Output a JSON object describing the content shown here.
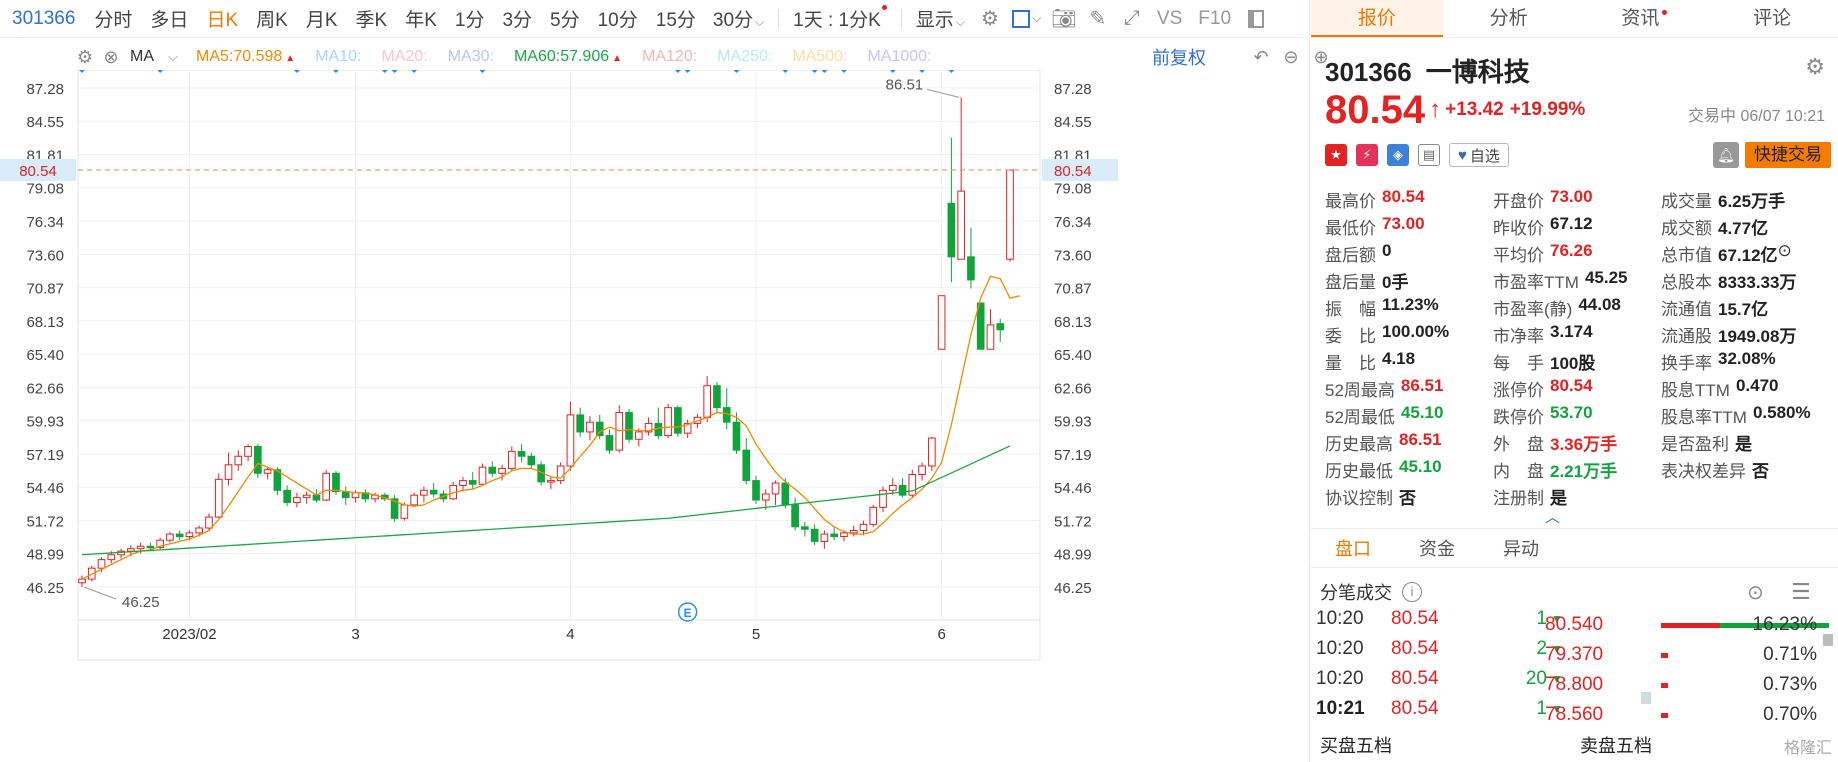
{
  "toolbar": {
    "code": "301366",
    "periods": [
      "分时",
      "多日",
      "日K",
      "周K",
      "月K",
      "季K",
      "年K",
      "1分",
      "3分",
      "5分",
      "10分",
      "15分"
    ],
    "active_period": "日K",
    "dropdown_30": "30分",
    "dropdown_day": "1天 : 1分K",
    "display_label": "显示",
    "vs_label": "VS",
    "f10_label": "F10"
  },
  "ma": {
    "label": "MA",
    "items": [
      {
        "name": "MA5:",
        "value": "70.598",
        "color": "#f08a00",
        "up": true
      },
      {
        "name": "MA10:",
        "value": "",
        "color": "#a8d4f5",
        "up": false
      },
      {
        "name": "MA20:",
        "value": "",
        "color": "#f5c4d8",
        "up": false
      },
      {
        "name": "MA30:",
        "value": "",
        "color": "#b8c8e6",
        "up": false
      },
      {
        "name": "MA60:",
        "value": "57.906",
        "color": "#1aa845",
        "up": true
      },
      {
        "name": "MA120:",
        "value": "",
        "color": "#f5b5b5",
        "up": false
      },
      {
        "name": "MA250:",
        "value": "",
        "color": "#b5ebf0",
        "up": false
      },
      {
        "name": "MA500:",
        "value": "",
        "color": "#f7e0a0",
        "up": false
      },
      {
        "name": "MA1000:",
        "value": "",
        "color": "#c9c6ea",
        "up": false
      }
    ],
    "adjust_label": "前复权"
  },
  "chart_data": {
    "type": "candlestick",
    "y_ticks": [
      "87.28",
      "84.55",
      "81.81",
      "79.08",
      "76.34",
      "73.60",
      "70.87",
      "68.13",
      "65.40",
      "62.66",
      "59.93",
      "57.19",
      "54.46",
      "51.72",
      "48.99",
      "46.25"
    ],
    "ylim": [
      46.25,
      87.28
    ],
    "x_labels": [
      {
        "label": "2023/02",
        "index": 11
      },
      {
        "label": "3",
        "index": 28
      },
      {
        "label": "4",
        "index": 50
      },
      {
        "label": "5",
        "index": 69
      },
      {
        "label": "6",
        "index": 88
      }
    ],
    "current_price": "80.54",
    "max_label": "86.51",
    "min_label": "46.25",
    "event_marker": "E",
    "event_index": 62,
    "signal_indices": [
      0,
      8,
      22,
      26,
      31,
      32,
      34,
      41,
      61,
      62,
      67,
      72,
      75,
      76,
      78,
      83,
      86,
      89
    ],
    "candles": [
      {
        "o": 46.6,
        "h": 47.2,
        "l": 46.25,
        "c": 46.9
      },
      {
        "o": 46.9,
        "h": 48.0,
        "l": 46.7,
        "c": 47.8
      },
      {
        "o": 47.8,
        "h": 48.7,
        "l": 47.5,
        "c": 48.5
      },
      {
        "o": 48.5,
        "h": 49.2,
        "l": 48.2,
        "c": 48.9
      },
      {
        "o": 48.9,
        "h": 49.4,
        "l": 48.6,
        "c": 49.2
      },
      {
        "o": 49.2,
        "h": 49.7,
        "l": 48.8,
        "c": 49.4
      },
      {
        "o": 49.4,
        "h": 49.9,
        "l": 49.0,
        "c": 49.6
      },
      {
        "o": 49.6,
        "h": 49.9,
        "l": 49.2,
        "c": 49.5
      },
      {
        "o": 49.5,
        "h": 50.3,
        "l": 49.3,
        "c": 50.1
      },
      {
        "o": 50.1,
        "h": 50.8,
        "l": 49.9,
        "c": 50.6
      },
      {
        "o": 50.6,
        "h": 50.9,
        "l": 50.1,
        "c": 50.4
      },
      {
        "o": 50.4,
        "h": 50.9,
        "l": 50.1,
        "c": 50.7
      },
      {
        "o": 50.7,
        "h": 51.3,
        "l": 50.4,
        "c": 51.1
      },
      {
        "o": 51.1,
        "h": 52.3,
        "l": 50.9,
        "c": 52.0
      },
      {
        "o": 52.0,
        "h": 55.6,
        "l": 51.9,
        "c": 55.1
      },
      {
        "o": 55.1,
        "h": 57.3,
        "l": 54.6,
        "c": 56.3
      },
      {
        "o": 56.3,
        "h": 57.5,
        "l": 55.8,
        "c": 57.0
      },
      {
        "o": 57.0,
        "h": 58.0,
        "l": 56.6,
        "c": 57.8
      },
      {
        "o": 57.8,
        "h": 58.0,
        "l": 55.2,
        "c": 55.6
      },
      {
        "o": 55.6,
        "h": 56.1,
        "l": 55.1,
        "c": 55.9
      },
      {
        "o": 55.9,
        "h": 56.1,
        "l": 53.8,
        "c": 54.2
      },
      {
        "o": 54.2,
        "h": 54.6,
        "l": 52.9,
        "c": 53.2
      },
      {
        "o": 53.2,
        "h": 54.0,
        "l": 52.8,
        "c": 53.6
      },
      {
        "o": 53.6,
        "h": 54.1,
        "l": 53.1,
        "c": 53.8
      },
      {
        "o": 53.8,
        "h": 54.3,
        "l": 53.2,
        "c": 53.4
      },
      {
        "o": 53.4,
        "h": 55.9,
        "l": 53.3,
        "c": 55.6
      },
      {
        "o": 55.6,
        "h": 55.8,
        "l": 53.8,
        "c": 54.1
      },
      {
        "o": 54.1,
        "h": 54.5,
        "l": 53.0,
        "c": 53.6
      },
      {
        "o": 53.6,
        "h": 54.2,
        "l": 53.2,
        "c": 54.0
      },
      {
        "o": 54.0,
        "h": 54.3,
        "l": 53.2,
        "c": 53.5
      },
      {
        "o": 53.5,
        "h": 54.0,
        "l": 53.2,
        "c": 53.8
      },
      {
        "o": 53.8,
        "h": 54.0,
        "l": 53.3,
        "c": 53.5
      },
      {
        "o": 53.5,
        "h": 53.8,
        "l": 51.6,
        "c": 51.9
      },
      {
        "o": 51.9,
        "h": 53.2,
        "l": 51.7,
        "c": 53.0
      },
      {
        "o": 53.0,
        "h": 54.0,
        "l": 52.8,
        "c": 53.8
      },
      {
        "o": 53.8,
        "h": 54.5,
        "l": 53.2,
        "c": 54.2
      },
      {
        "o": 54.2,
        "h": 54.8,
        "l": 53.6,
        "c": 53.9
      },
      {
        "o": 53.9,
        "h": 54.2,
        "l": 53.2,
        "c": 53.5
      },
      {
        "o": 53.5,
        "h": 54.9,
        "l": 53.4,
        "c": 54.6
      },
      {
        "o": 54.6,
        "h": 55.3,
        "l": 54.1,
        "c": 55.0
      },
      {
        "o": 55.0,
        "h": 55.7,
        "l": 54.3,
        "c": 54.7
      },
      {
        "o": 54.7,
        "h": 56.4,
        "l": 54.6,
        "c": 56.1
      },
      {
        "o": 56.1,
        "h": 56.6,
        "l": 55.3,
        "c": 55.6
      },
      {
        "o": 55.6,
        "h": 56.3,
        "l": 55.0,
        "c": 56.0
      },
      {
        "o": 56.0,
        "h": 57.8,
        "l": 55.8,
        "c": 57.4
      },
      {
        "o": 57.4,
        "h": 58.0,
        "l": 56.5,
        "c": 57.0
      },
      {
        "o": 57.0,
        "h": 57.3,
        "l": 56.0,
        "c": 56.3
      },
      {
        "o": 56.3,
        "h": 56.6,
        "l": 54.6,
        "c": 54.9
      },
      {
        "o": 54.9,
        "h": 55.3,
        "l": 54.3,
        "c": 55.0
      },
      {
        "o": 55.0,
        "h": 56.5,
        "l": 54.7,
        "c": 56.2
      },
      {
        "o": 56.2,
        "h": 61.5,
        "l": 55.8,
        "c": 60.4
      },
      {
        "o": 60.4,
        "h": 61.0,
        "l": 58.6,
        "c": 59.0
      },
      {
        "o": 59.0,
        "h": 60.3,
        "l": 58.3,
        "c": 59.8
      },
      {
        "o": 59.8,
        "h": 60.4,
        "l": 58.4,
        "c": 58.7
      },
      {
        "o": 58.7,
        "h": 59.2,
        "l": 57.2,
        "c": 57.5
      },
      {
        "o": 57.5,
        "h": 61.2,
        "l": 57.3,
        "c": 60.6
      },
      {
        "o": 60.6,
        "h": 60.9,
        "l": 58.1,
        "c": 58.4
      },
      {
        "o": 58.4,
        "h": 59.3,
        "l": 57.8,
        "c": 59.0
      },
      {
        "o": 59.0,
        "h": 60.2,
        "l": 58.7,
        "c": 59.7
      },
      {
        "o": 59.7,
        "h": 61.0,
        "l": 58.4,
        "c": 58.7
      },
      {
        "o": 58.7,
        "h": 61.3,
        "l": 58.5,
        "c": 61.0
      },
      {
        "o": 61.0,
        "h": 61.2,
        "l": 58.6,
        "c": 58.9
      },
      {
        "o": 58.9,
        "h": 60.0,
        "l": 58.5,
        "c": 59.7
      },
      {
        "o": 59.7,
        "h": 60.5,
        "l": 59.3,
        "c": 60.2
      },
      {
        "o": 60.2,
        "h": 63.6,
        "l": 59.8,
        "c": 62.8
      },
      {
        "o": 62.8,
        "h": 63.1,
        "l": 60.5,
        "c": 61.0
      },
      {
        "o": 61.0,
        "h": 62.6,
        "l": 59.2,
        "c": 59.8
      },
      {
        "o": 59.8,
        "h": 60.6,
        "l": 57.2,
        "c": 57.5
      },
      {
        "o": 57.5,
        "h": 58.5,
        "l": 54.7,
        "c": 55.0
      },
      {
        "o": 55.0,
        "h": 55.4,
        "l": 53.1,
        "c": 53.4
      },
      {
        "o": 53.4,
        "h": 54.3,
        "l": 52.6,
        "c": 53.9
      },
      {
        "o": 53.9,
        "h": 55.0,
        "l": 53.0,
        "c": 54.8
      },
      {
        "o": 54.8,
        "h": 55.2,
        "l": 52.7,
        "c": 53.0
      },
      {
        "o": 53.0,
        "h": 53.6,
        "l": 50.9,
        "c": 51.2
      },
      {
        "o": 51.2,
        "h": 51.6,
        "l": 50.4,
        "c": 51.0
      },
      {
        "o": 51.0,
        "h": 51.4,
        "l": 49.7,
        "c": 50.0
      },
      {
        "o": 50.0,
        "h": 50.9,
        "l": 49.4,
        "c": 50.6
      },
      {
        "o": 50.6,
        "h": 51.2,
        "l": 50.1,
        "c": 50.4
      },
      {
        "o": 50.4,
        "h": 50.9,
        "l": 50.0,
        "c": 50.7
      },
      {
        "o": 50.7,
        "h": 51.3,
        "l": 50.4,
        "c": 50.9
      },
      {
        "o": 50.9,
        "h": 51.7,
        "l": 50.5,
        "c": 51.4
      },
      {
        "o": 51.4,
        "h": 53.0,
        "l": 51.2,
        "c": 52.8
      },
      {
        "o": 52.8,
        "h": 54.5,
        "l": 52.4,
        "c": 54.2
      },
      {
        "o": 54.2,
        "h": 55.2,
        "l": 53.8,
        "c": 54.6
      },
      {
        "o": 54.6,
        "h": 55.2,
        "l": 53.6,
        "c": 53.8
      },
      {
        "o": 53.8,
        "h": 55.9,
        "l": 53.6,
        "c": 55.5
      },
      {
        "o": 55.5,
        "h": 56.5,
        "l": 55.0,
        "c": 56.2
      },
      {
        "o": 56.2,
        "h": 58.6,
        "l": 55.8,
        "c": 58.5
      },
      {
        "o": 65.8,
        "h": 70.2,
        "l": 65.8,
        "c": 70.2
      },
      {
        "o": 77.8,
        "h": 83.2,
        "l": 71.3,
        "c": 73.4
      },
      {
        "o": 73.2,
        "h": 86.51,
        "l": 73.2,
        "c": 78.8
      },
      {
        "o": 73.4,
        "h": 75.8,
        "l": 70.8,
        "c": 71.5
      },
      {
        "o": 69.6,
        "h": 69.6,
        "l": 65.8,
        "c": 65.8
      },
      {
        "o": 65.8,
        "h": 69.1,
        "l": 65.8,
        "c": 67.8
      },
      {
        "o": 67.9,
        "h": 68.3,
        "l": 66.4,
        "c": 67.4
      },
      {
        "o": 73.2,
        "h": 80.54,
        "l": 73.0,
        "c": 80.54
      }
    ],
    "ma5": [
      46.9,
      47.3,
      47.7,
      48.1,
      48.5,
      48.9,
      49.2,
      49.3,
      49.6,
      49.8,
      50.0,
      50.2,
      50.5,
      50.9,
      51.8,
      52.9,
      54.1,
      55.3,
      56.4,
      56.1,
      55.8,
      55.3,
      54.8,
      54.3,
      53.8,
      54.2,
      54.2,
      54.1,
      54.0,
      54.0,
      53.8,
      53.6,
      53.3,
      53.0,
      52.9,
      53.0,
      53.4,
      53.7,
      54.0,
      54.2,
      54.3,
      54.6,
      55.0,
      55.3,
      55.8,
      56.0,
      56.0,
      55.7,
      55.3,
      55.2,
      56.0,
      57.0,
      57.9,
      59.0,
      59.4,
      59.1,
      59.2,
      59.1,
      59.1,
      59.3,
      59.4,
      59.4,
      59.6,
      59.9,
      60.2,
      60.6,
      60.5,
      60.2,
      59.5,
      58.0,
      56.8,
      55.7,
      54.9,
      54.3,
      53.6,
      52.7,
      51.8,
      51.2,
      50.8,
      50.6,
      50.6,
      50.8,
      51.5,
      52.3,
      53.0,
      53.6,
      54.3,
      55.2,
      56.5,
      59.6,
      63.3,
      67.0,
      70.0,
      71.8,
      71.6,
      70.0,
      70.2
    ]
  },
  "tabs": [
    "报价",
    "分析",
    "资讯",
    "评论"
  ],
  "stock": {
    "code": "301366",
    "name": "一博科技",
    "price": "80.54",
    "change": "+13.42",
    "change_pct": "+19.99%",
    "status": "交易中 06/07 10:21",
    "watch_label": "自选",
    "fast_trade_label": "快捷交易"
  },
  "stats": [
    [
      {
        "k": "最高价",
        "v": "80.54",
        "c": "red"
      },
      {
        "k": "开盘价",
        "v": "73.00",
        "c": "red"
      },
      {
        "k": "成交量",
        "v": "6.25万手",
        "c": ""
      }
    ],
    [
      {
        "k": "最低价",
        "v": "73.00",
        "c": "red"
      },
      {
        "k": "昨收价",
        "v": "67.12",
        "c": ""
      },
      {
        "k": "成交额",
        "v": "4.77亿",
        "c": ""
      }
    ],
    [
      {
        "k": "盘后额",
        "v": "0",
        "c": ""
      },
      {
        "k": "平均价",
        "v": "76.26",
        "c": "red"
      },
      {
        "k": "总市值",
        "v": "67.12亿",
        "c": ""
      }
    ],
    [
      {
        "k": "盘后量",
        "v": "0手",
        "c": ""
      },
      {
        "k": "市盈率TTM",
        "v": "45.25",
        "c": ""
      },
      {
        "k": "总股本",
        "v": "8333.33万",
        "c": ""
      }
    ],
    [
      {
        "k": "振　幅",
        "v": "11.23%",
        "c": ""
      },
      {
        "k": "市盈率(静)",
        "v": "44.08",
        "c": ""
      },
      {
        "k": "流通值",
        "v": "15.7亿",
        "c": ""
      }
    ],
    [
      {
        "k": "委　比",
        "v": "100.00%",
        "c": ""
      },
      {
        "k": "市净率",
        "v": "3.174",
        "c": ""
      },
      {
        "k": "流通股",
        "v": "1949.08万",
        "c": ""
      }
    ],
    [
      {
        "k": "量　比",
        "v": "4.18",
        "c": ""
      },
      {
        "k": "每　手",
        "v": "100股",
        "c": ""
      },
      {
        "k": "换手率",
        "v": "32.08%",
        "c": ""
      }
    ],
    [
      {
        "k": "52周最高",
        "v": "86.51",
        "c": "red"
      },
      {
        "k": "涨停价",
        "v": "80.54",
        "c": "red"
      },
      {
        "k": "股息TTM",
        "v": "0.470",
        "c": ""
      }
    ],
    [
      {
        "k": "52周最低",
        "v": "45.10",
        "c": "green"
      },
      {
        "k": "跌停价",
        "v": "53.70",
        "c": "green"
      },
      {
        "k": "股息率TTM",
        "v": "0.580%",
        "c": ""
      }
    ],
    [
      {
        "k": "历史最高",
        "v": "86.51",
        "c": "red"
      },
      {
        "k": "外　盘",
        "v": "3.36万手",
        "c": "red"
      },
      {
        "k": "是否盈利",
        "v": "是",
        "c": ""
      }
    ],
    [
      {
        "k": "历史最低",
        "v": "45.10",
        "c": "green"
      },
      {
        "k": "内　盘",
        "v": "2.21万手",
        "c": "green"
      },
      {
        "k": "表决权差异",
        "v": "否",
        "c": ""
      }
    ],
    [
      {
        "k": "协议控制",
        "v": "否",
        "c": ""
      },
      {
        "k": "注册制",
        "v": "是",
        "c": ""
      },
      {
        "k": "",
        "v": "",
        "c": ""
      }
    ]
  ],
  "subtabs": [
    "盘口",
    "资金",
    "异动"
  ],
  "trades_title": "分笔成交",
  "trades": [
    {
      "time": "10:20",
      "price": "80.54",
      "vol": "1"
    },
    {
      "time": "10:20",
      "price": "80.54",
      "vol": "2"
    },
    {
      "time": "10:20",
      "price": "80.54",
      "vol": "20"
    },
    {
      "time": "10:21",
      "price": "80.54",
      "vol": "1"
    }
  ],
  "depth": [
    {
      "price": "80.540",
      "pct": "16.23%",
      "bar": 1.0
    },
    {
      "price": "79.370",
      "pct": "0.71%",
      "bar": 0.04
    },
    {
      "price": "78.800",
      "pct": "0.73%",
      "bar": 0.04
    },
    {
      "price": "78.560",
      "pct": "0.70%",
      "bar": 0.04
    }
  ],
  "footer": {
    "buy": "买盘五档",
    "sell": "卖盘五档",
    "watermark": "格隆汇"
  }
}
